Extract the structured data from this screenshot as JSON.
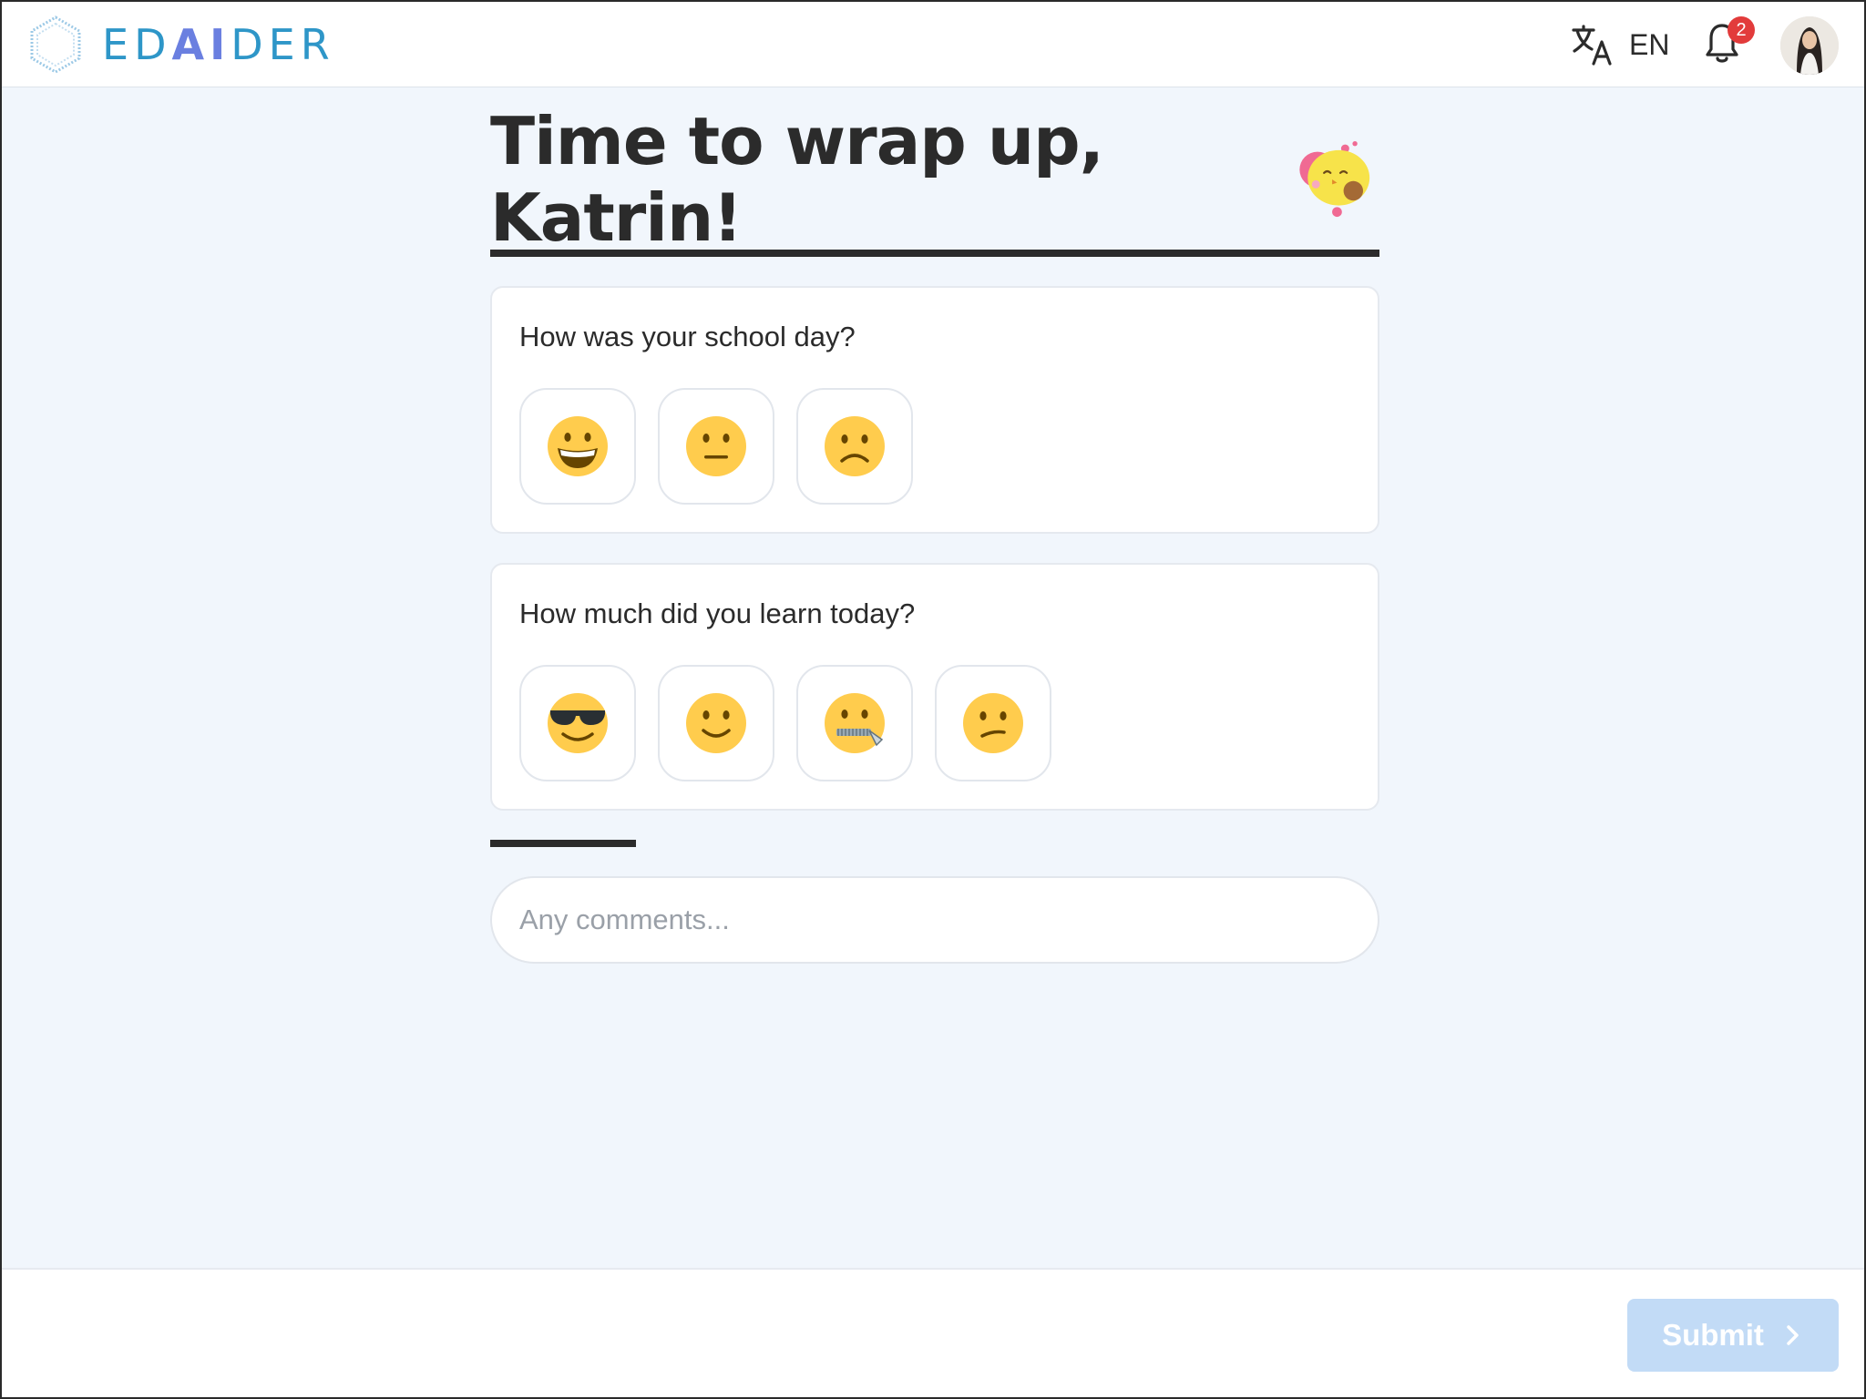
{
  "header": {
    "logo": {
      "pre": "ED",
      "hl": "AI",
      "post": "DER"
    },
    "language_code": "EN",
    "notifications_count": "2",
    "icons": [
      "translate-icon",
      "bell-icon",
      "avatar"
    ]
  },
  "main": {
    "title": "Time to wrap up, Katrin!",
    "questions": [
      {
        "text": "How was your school day?",
        "options": [
          "grinning-face",
          "neutral-face",
          "frowning-face"
        ]
      },
      {
        "text": "How much did you learn today?",
        "options": [
          "sunglasses-face",
          "slightly-smiling-face",
          "zipper-mouth-face",
          "confused-face"
        ]
      }
    ],
    "comment_placeholder": "Any comments..."
  },
  "footer": {
    "submit_label": "Submit"
  },
  "colors": {
    "accent": "#2e96c8",
    "submit_bg": "#c2dbf6",
    "emoji": "#ffcc4d",
    "badge": "#e23b3b"
  }
}
